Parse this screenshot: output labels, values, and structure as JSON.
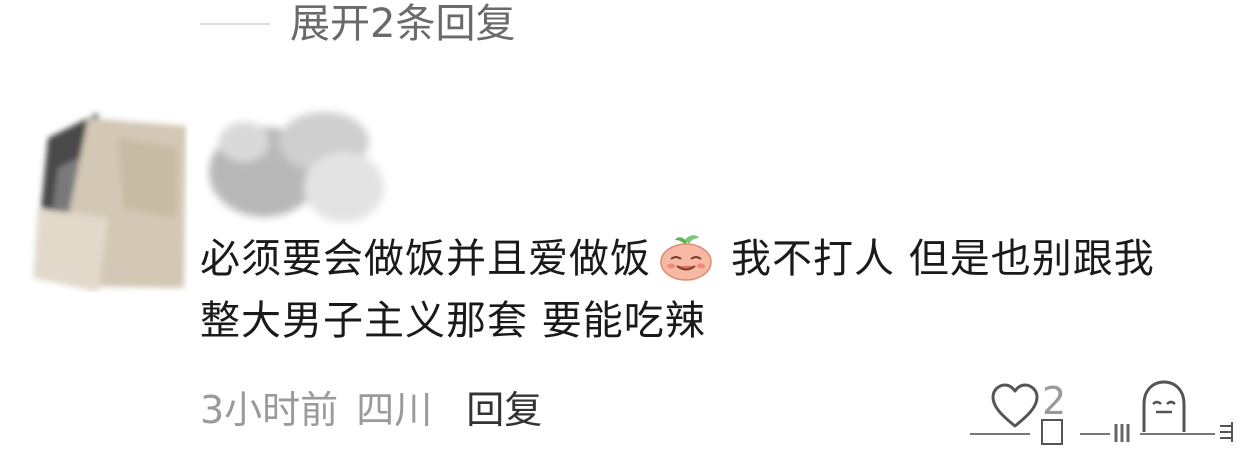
{
  "expand": {
    "label": "展开2条回复"
  },
  "comment": {
    "text_part1": "必须要会做饭并且爱做饭",
    "emoji": "smiling-face-emoji",
    "text_part2": "我不打人 但是也别跟我整大男子主义那套  要能吃辣",
    "time": "3小时前",
    "location": "四川",
    "reply_label": "回复",
    "like_count": "2"
  },
  "icons": {
    "like": "heart-icon",
    "reaction": "face-icon"
  },
  "colors": {
    "primary_text": "#1a1a1a",
    "secondary_text": "#9a9a9a",
    "expand_text": "#6a6a6a",
    "reply_text": "#333333",
    "emoji_fill": "#f7b9a3",
    "emoji_leaf": "#7cc576"
  }
}
